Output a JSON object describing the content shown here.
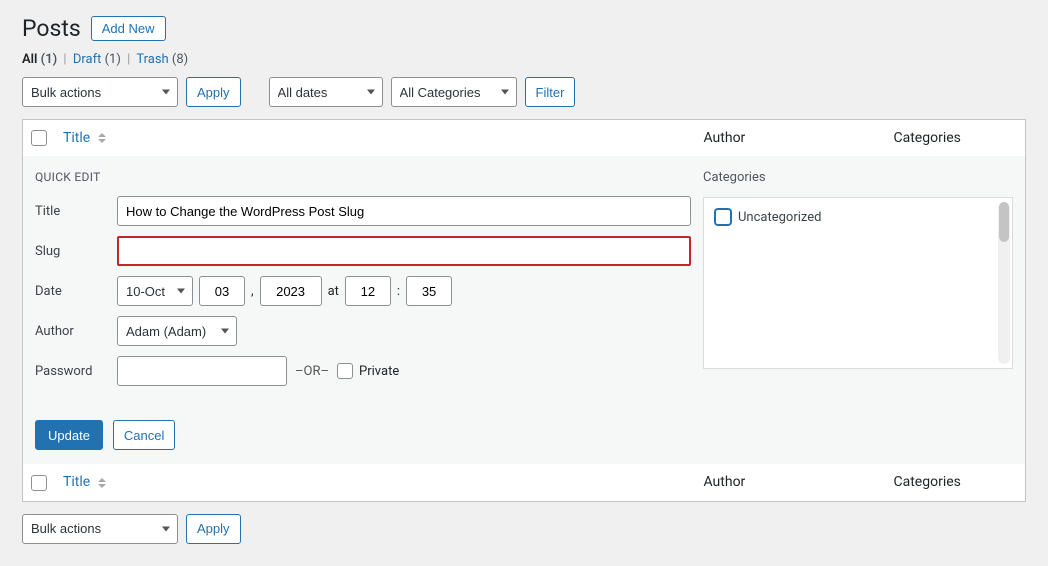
{
  "header": {
    "title": "Posts",
    "add_new": "Add New"
  },
  "views": {
    "all_label": "All",
    "all_count": "(1)",
    "draft_label": "Draft",
    "draft_count": "(1)",
    "trash_label": "Trash",
    "trash_count": "(8)"
  },
  "filters": {
    "bulk_actions": "Bulk actions",
    "apply": "Apply",
    "all_dates": "All dates",
    "all_categories": "All Categories",
    "filter": "Filter"
  },
  "columns": {
    "title": "Title",
    "author": "Author",
    "categories": "Categories"
  },
  "quick_edit": {
    "heading": "QUICK EDIT",
    "labels": {
      "title": "Title",
      "slug": "Slug",
      "date": "Date",
      "author": "Author",
      "password": "Password",
      "or": "–OR–",
      "private": "Private",
      "at": "at",
      "categories": "Categories"
    },
    "values": {
      "title": "How to Change the WordPress Post Slug",
      "slug": "",
      "month": "10-Oct",
      "day": "03",
      "year": "2023",
      "hour": "12",
      "minute": "35",
      "author": "Adam (Adam)",
      "password": ""
    },
    "categories": {
      "items": [
        {
          "label": "Uncategorized",
          "checked": false
        }
      ]
    },
    "buttons": {
      "update": "Update",
      "cancel": "Cancel"
    }
  },
  "bottom": {
    "bulk_actions": "Bulk actions",
    "apply": "Apply"
  }
}
